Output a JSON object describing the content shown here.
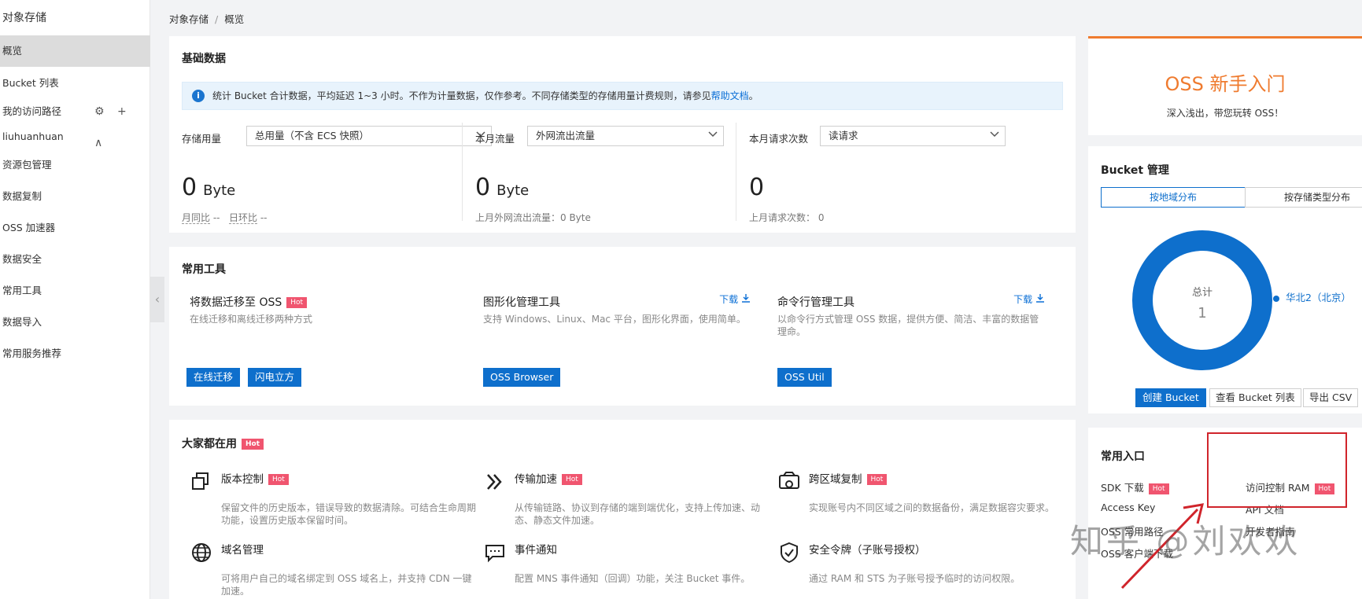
{
  "sidebar": {
    "title": "对象存储",
    "items": [
      {
        "label": "概览",
        "active": true
      },
      {
        "label": "Bucket 列表"
      },
      {
        "label": "我的访问路径"
      },
      {
        "label": "liuhuanhuan"
      },
      {
        "label": "资源包管理"
      },
      {
        "label": "数据复制"
      },
      {
        "label": "OSS 加速器"
      },
      {
        "label": "数据安全"
      },
      {
        "label": "常用工具"
      },
      {
        "label": "数据导入"
      },
      {
        "label": "常用服务推荐"
      }
    ],
    "path_ops": "⚙ + ∧",
    "collapse": "‹"
  },
  "breadcrumb": {
    "root": "对象存储",
    "sep": "/",
    "current": "概览"
  },
  "basic": {
    "title": "基础数据",
    "info_text": "统计 Bucket 合计数据，平均延迟 1~3 小时。不作为计量数据，仅作参考。不同存储类型的存储用量计费规则，请参见",
    "info_link": "帮助文档",
    "info_end": "。",
    "cols": [
      {
        "label": "存储用量",
        "select": "总用量（不含 ECS 快照）",
        "value": "0",
        "unit": "Byte",
        "sub1": "月同比",
        "sub1_val": "--",
        "sub2": "日环比",
        "sub2_val": "--"
      },
      {
        "label": "本月流量",
        "select": "外网流出流量",
        "value": "0",
        "unit": "Byte",
        "sub": "上月外网流出流量：0 Byte"
      },
      {
        "label": "本月请求次数",
        "select": "读请求",
        "value": "0",
        "unit": "",
        "sub": "上月请求次数：  0"
      }
    ]
  },
  "tools": {
    "title": "常用工具",
    "items": [
      {
        "title": "将数据迁移至 OSS",
        "hot": "Hot",
        "desc": "在线迁移和离线迁移两种方式",
        "buttons": [
          "在线迁移",
          "闪电立方"
        ]
      },
      {
        "title": "图形化管理工具",
        "download": "下载",
        "desc": "支持 Windows、Linux、Mac 平台，图形化界面，使用简单。",
        "buttons": [
          "OSS Browser"
        ]
      },
      {
        "title": "命令行管理工具",
        "download": "下载",
        "desc": "以命令行方式管理 OSS 数据，提供方便、简洁、丰富的数据管理命。",
        "buttons": [
          "OSS Util"
        ]
      }
    ]
  },
  "popular": {
    "title": "大家都在用",
    "hot": "Hot",
    "items": [
      {
        "title": "版本控制",
        "hot": "Hot",
        "desc": "保留文件的历史版本，错误导致的数据清除。可结合生命周期功能，设置历史版本保留时间。",
        "icon": "copy-icon"
      },
      {
        "title": "传输加速",
        "hot": "Hot",
        "desc": "从传输链路、协议到存储的端到端优化，支持上传加速、动态、静态文件加速。",
        "icon": "double-chevron-icon"
      },
      {
        "title": "跨区域复制",
        "hot": "Hot",
        "desc": "实现账号内不同区域之间的数据备份，满足数据容灾要求。",
        "icon": "cross-region-icon"
      },
      {
        "title": "域名管理",
        "desc": "可将用户自己的域名绑定到 OSS 域名上，并支持 CDN 一键加速。",
        "icon": "globe-icon"
      },
      {
        "title": "事件通知",
        "desc": "配置 MNS 事件通知（回调）功能，关注 Bucket 事件。",
        "icon": "message-icon"
      },
      {
        "title": "安全令牌（子账号授权）",
        "desc": "通过 RAM 和 STS 为子账号授予临时的访问权限。",
        "icon": "shield-icon"
      }
    ]
  },
  "newbie": {
    "title": "OSS 新手入门",
    "subtitle": "深入浅出，带您玩转 OSS！"
  },
  "bucket_mgmt": {
    "title": "Bucket 管理",
    "tabs": [
      "按地域分布",
      "按存储类型分布"
    ],
    "total_label": "总计",
    "total_value": "1",
    "legend": "华北2（北京）",
    "buttons": [
      "创建 Bucket",
      "查看 Bucket 列表",
      "导出 CSV"
    ]
  },
  "entries": {
    "title": "常用入口",
    "items": [
      {
        "label": "SDK 下载",
        "hot": "Hot"
      },
      {
        "label": "访问控制 RAM",
        "hot": "Hot"
      },
      {
        "label": "Access Key"
      },
      {
        "label": "API 文档"
      },
      {
        "label": "OSS 常用路径"
      },
      {
        "label": "开发者指南"
      },
      {
        "label": "OSS 客户端下载"
      }
    ]
  },
  "watermark": "知乎 @刘欢欢",
  "colors": {
    "primary": "#0e6fcc",
    "hot": "#f0556f",
    "orange": "#ef7b2f",
    "annotation": "#d0242b"
  }
}
